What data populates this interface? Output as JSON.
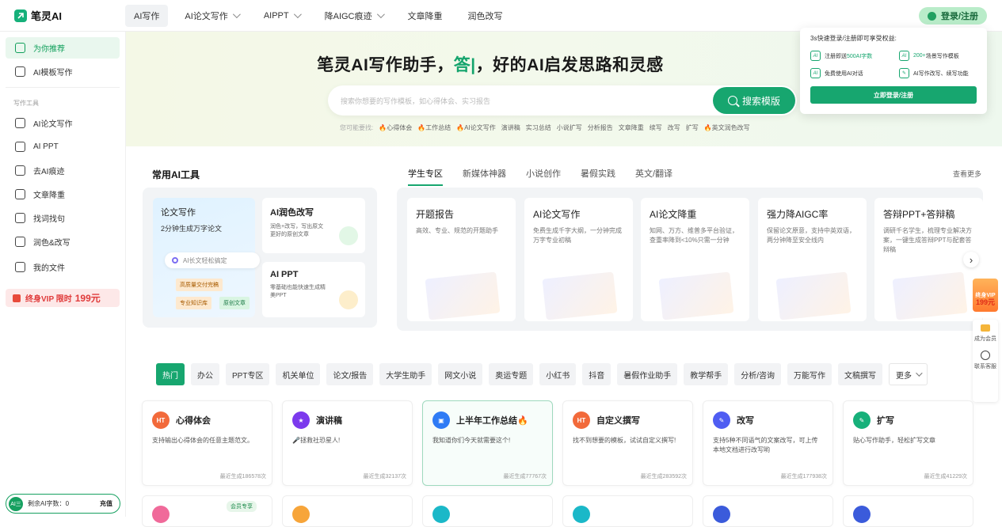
{
  "app": {
    "name": "笔灵AI"
  },
  "nav": {
    "items": [
      {
        "label": "AI写作",
        "dropdown": false,
        "active": true
      },
      {
        "label": "AI论文写作",
        "dropdown": true
      },
      {
        "label": "AIPPT",
        "dropdown": true
      },
      {
        "label": "降AIGC痕迹",
        "dropdown": true
      },
      {
        "label": "文章降重",
        "dropdown": false
      },
      {
        "label": "润色改写",
        "dropdown": false
      }
    ],
    "login_label": "登录/注册"
  },
  "sidebar": {
    "top_items": [
      {
        "label": "为你推荐",
        "icon": "home-icon",
        "active": true
      },
      {
        "label": "AI模板写作",
        "icon": "ai-template-icon"
      }
    ],
    "section_label": "写作工具",
    "tool_items": [
      {
        "label": "AI论文写作",
        "icon": "paper-icon"
      },
      {
        "label": "AI PPT",
        "icon": "ppt-icon"
      },
      {
        "label": "去AI痕迹",
        "icon": "remove-ai-icon"
      },
      {
        "label": "文章降重",
        "icon": "rewrite-doc-icon"
      },
      {
        "label": "找词找句",
        "icon": "find-words-icon"
      },
      {
        "label": "润色&改写",
        "icon": "polish-icon"
      },
      {
        "label": "我的文件",
        "icon": "file-icon"
      }
    ],
    "vip": {
      "text": "终身VIP 限时",
      "price": "199元"
    },
    "credit": {
      "badge": "AI三",
      "label": "剩余AI字数：",
      "value": "0",
      "action": "充值"
    }
  },
  "hero": {
    "title_a": "笔灵AI写作助手，",
    "title_b": "答|",
    "title_c": "，好的AI启发思路和灵感",
    "search_placeholder": "搜索你想要的写作模板，如心得体会、实习报告",
    "search_button": "搜索模版",
    "hints_lead": "您可能要找:",
    "hints": [
      "🔥心得体会",
      "🔥工作总结",
      "🔥AI论文写作",
      "演讲稿",
      "实习总结",
      "小说扩写",
      "分析报告",
      "文章降重",
      "续写",
      "改写",
      "扩写",
      "🔥英文润色改写"
    ]
  },
  "popup": {
    "title": "3s快速登录/注册即可享受权益:",
    "perks": [
      {
        "icon": "AI",
        "pre": "注册即送",
        "hl": "500AI字数",
        "post": ""
      },
      {
        "icon": "AI",
        "pre": "",
        "hl": "200+",
        "post": "场景写作模板"
      },
      {
        "icon": "AI",
        "pre": "免费使用AI对话",
        "hl": "",
        "post": ""
      },
      {
        "icon": "✎",
        "pre": "AI写作改写、续写功能",
        "hl": "",
        "post": ""
      }
    ],
    "button": "立即登录/注册"
  },
  "tools_section": {
    "title": "常用AI工具",
    "main_card": {
      "title": "论文写作",
      "subtitle": "2分钟生成万字论文",
      "pill": "AI长文轻松搞定",
      "tags": [
        "高质量交付完稿",
        "专业知识库",
        "原创文章"
      ]
    },
    "sub_cards": [
      {
        "title": "AI润色改写",
        "desc": "润色+改写，写出原文更好的原创文章"
      },
      {
        "title": "AI PPT",
        "desc": "零基础也能快速生成精美PPT"
      }
    ]
  },
  "tabs": {
    "items": [
      "学生专区",
      "新媒体神器",
      "小说创作",
      "暑假实践",
      "英文/翻译"
    ],
    "active": 0,
    "see_more": "查看更多"
  },
  "tool_cards": [
    {
      "title": "开题报告",
      "desc": "高效、专业、规范的开题助手"
    },
    {
      "title": "AI论文写作",
      "desc": "免费生成千字大纲，一分钟完成万字专业初稿"
    },
    {
      "title": "AI论文降重",
      "desc": "知网、万方、维普多平台验证，查重率降到<10%只需一分钟"
    },
    {
      "title": "强力降AIGC率",
      "desc": "保留论文原意，支持中英双语，两分钟降至安全线内"
    },
    {
      "title": "答辩PPT+答辩稿",
      "desc": "调研千名学生，梳理专业解决方案，一键生成答辩PPT与配套答辩稿"
    }
  ],
  "float": {
    "vip_a": "终身VIP",
    "vip_price": "199元",
    "member": "成为会员",
    "service": "联系客服"
  },
  "categories": {
    "items": [
      "热门",
      "办公",
      "PPT专区",
      "机关单位",
      "论文/报告",
      "大学生助手",
      "网文小说",
      "奥运专题",
      "小红书",
      "抖音",
      "暑假作业助手",
      "教学帮手",
      "分析/咨询",
      "万能写作",
      "文稿撰写"
    ],
    "more": "更多",
    "active": 0
  },
  "templates": [
    {
      "title": "心得体会",
      "desc": "支持输出心得体会的任意主题范文。",
      "footer": "最近生成186578次",
      "badge": "HT",
      "color": "#f26a3b"
    },
    {
      "title": "演讲稿",
      "desc": "🎤拯救社恐星人!",
      "footer": "最近生成32137次",
      "badge": "★",
      "color": "#7c3aed"
    },
    {
      "title": "上半年工作总结🔥",
      "desc": "我知道你们今天就需要这个!",
      "footer": "最近生成77767次",
      "badge": "▣",
      "color": "#2f7bf5"
    },
    {
      "title": "自定义撰写",
      "desc": "找不到想要的模板，试试自定义撰写!",
      "footer": "最近生成283592次",
      "badge": "HT",
      "color": "#f26a3b"
    },
    {
      "title": "改写",
      "desc": "支持5种不同语气的文案改写，可上传本地文档进行改写哟",
      "footer": "最近生成177938次",
      "badge": "✎",
      "color": "#4f5df2"
    },
    {
      "title": "扩写",
      "desc": "贴心写作助手，轻松扩写文章",
      "footer": "最近生成41229次",
      "badge": "✎",
      "color": "#17b07a"
    }
  ],
  "member_tag": "会员专享"
}
